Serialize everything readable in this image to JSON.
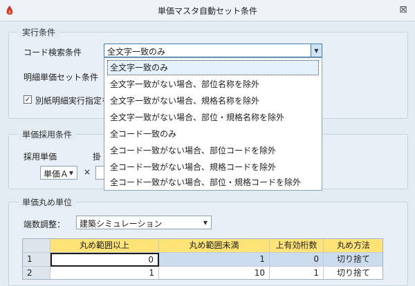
{
  "window": {
    "title": "単価マスタ自動セット条件",
    "close": "⊠"
  },
  "exec_group": {
    "title": "実行条件",
    "code_search_label": "コード検索条件",
    "code_search_value": "全文字一致のみ",
    "detail_label": "明細単価セット条件",
    "checkbox_label": "別紙明細実行指定を",
    "checkbox_checked": "✓"
  },
  "dropdown": {
    "options": [
      "全文字一致のみ",
      "全文字一致がない場合、部位名称を除外",
      "全文字一致がない場合、規格名称を除外",
      "全文字一致がない場合、部位・規格名称を除外",
      "全コード一致のみ",
      "全コード一致がない場合、部位コードを除外",
      "全コード一致がない場合、規格コードを除外",
      "全コード一致がない場合、部位・規格コードを除外"
    ]
  },
  "price_group": {
    "title": "単価採用条件",
    "adopt_label": "採用単価",
    "adopt_label2": "掛",
    "adopt_value": "単価Ａ",
    "times": "×"
  },
  "round_group": {
    "title": "単価丸め単位",
    "adjust_label": "端数調整：",
    "adjust_value": "建築シミュレーション"
  },
  "table": {
    "headers": [
      "丸め範囲以上",
      "丸め範囲未満",
      "上有効桁数",
      "丸め方法"
    ],
    "rows": [
      {
        "idx": "1",
        "c1": "0",
        "c2": "1",
        "c3": "0",
        "c4": "切り捨て"
      },
      {
        "idx": "2",
        "c1": "1",
        "c2": "10",
        "c3": "1",
        "c4": "切り捨て"
      }
    ]
  },
  "colors": {
    "header": "#ffe377",
    "background": "#e3ebf3",
    "accent": "#3c7fb1"
  }
}
